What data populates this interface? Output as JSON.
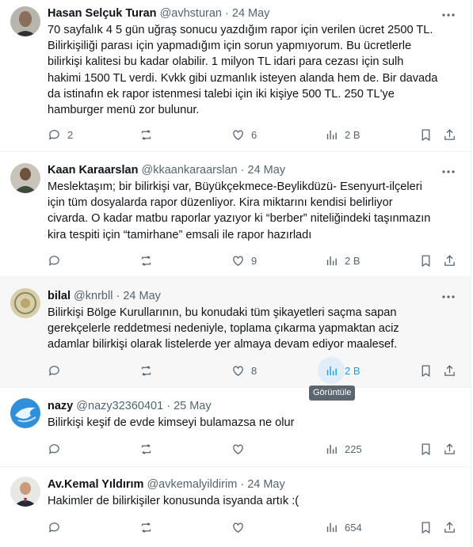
{
  "tweets": [
    {
      "name": "Hasan Selçuk Turan",
      "handle": "@avhsturan",
      "sep": "·",
      "date": "24 May",
      "lines": [
        "70 sayfalık 4 5 gün uğraş sonucu yazdığım rapor için verilen ücret 2500 TL.",
        "Bilirkişiliği parası için yapmadığım için sorun yapmıyorum. Bu ücretlerle",
        "bilirkişi kalitesi bu kadar olabilir. 1 milyon TL idari para cezası için sulh",
        "hakimi 1500 TL verdi. Kvkk gibi uzmanlık isteyen alanda hem de. Bir davada",
        "da istinafın ek rapor istenmesi talebi için iki kişiye 500 TL. 250 TL'ye",
        "hamburger menü zor bulunur."
      ],
      "replies": "2",
      "reposts": "",
      "likes": "6",
      "views": "2 B"
    },
    {
      "name": "Kaan Karaarslan",
      "handle": "@kkaankaraarslan",
      "sep": "·",
      "date": "24 May",
      "lines": [
        "Meslektaşım; bir bilirkişi var, Büyükçekmece-Beylikdüzü- Esenyurt-ilçeleri",
        "için tüm dosyalarda rapor düzenliyor. Kira miktarını kendisi belirliyor",
        "civarda. O kadar matbu raporlar yazıyor ki “berber” niteliğindeki taşınmazın",
        "kira tespiti için “tamirhane” emsali ile rapor hazırladı"
      ],
      "replies": "",
      "reposts": "",
      "likes": "9",
      "views": "2 B"
    },
    {
      "name": "bilal",
      "handle": "@knrbll",
      "sep": "·",
      "date": "24 May",
      "lines": [
        "Bilirkişi Bölge Kurullarının, bu konudaki tüm şikayetleri saçma sapan",
        "gerekçelerle reddetmesi nedeniyle, toplama çıkarma yapmaktan aciz",
        "adamlar bilirkişi olarak listelerde yer almaya devam ediyor maalesef."
      ],
      "replies": "",
      "reposts": "",
      "likes": "8",
      "views": "2 B"
    },
    {
      "name": "nazy",
      "handle": "@nazy32360401",
      "sep": "·",
      "date": "25 May",
      "lines": [
        "Bilirkişi keşif de evde kimseyi bulamazsa ne olur"
      ],
      "replies": "",
      "reposts": "",
      "likes": "",
      "views": "225"
    },
    {
      "name": "Av.Kemal Yıldırım",
      "handle": "@avkemalyildirim",
      "sep": "·",
      "date": "24 May",
      "lines": [
        "Hakimler de bilirkişiler konusunda isyanda artık :("
      ],
      "replies": "",
      "reposts": "",
      "likes": "",
      "views": "654"
    }
  ],
  "tooltip": "Görüntüle",
  "colors": {
    "accent": "#1d9bf0",
    "muted": "#536471",
    "text": "#0f1419",
    "hover_bg": "#f7f7f7"
  },
  "icons": [
    "reply-icon",
    "repost-icon",
    "like-icon",
    "views-icon",
    "bookmark-icon",
    "share-icon",
    "more-icon"
  ]
}
